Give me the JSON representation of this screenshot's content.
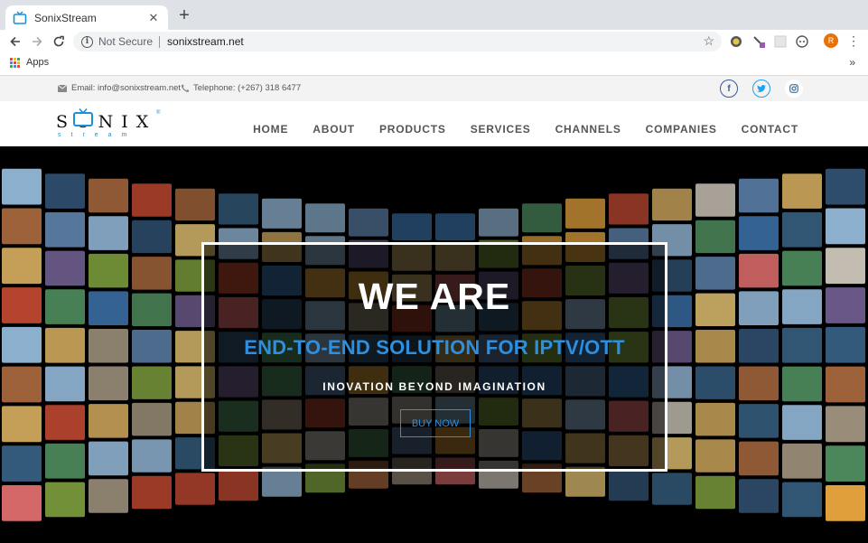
{
  "browser": {
    "tab_title": "SonixStream",
    "url_security": "Not Secure",
    "url": "sonixstream.net",
    "avatar_letter": "R",
    "bookmarks_apps": "Apps",
    "bookmarks_more": "»"
  },
  "topbar": {
    "email": "Email: info@sonixstream.net",
    "phone": "Telephone: (+267) 318 6477",
    "social": [
      "facebook-icon",
      "twitter-icon",
      "instagram-icon"
    ]
  },
  "logo": {
    "word": "SONIX",
    "sub": "stream",
    "reg": "®"
  },
  "nav": [
    "HOME",
    "ABOUT",
    "PRODUCTS",
    "SERVICES",
    "CHANNELS",
    "COMPANIES",
    "CONTACT"
  ],
  "hero": {
    "headline": "WE ARE",
    "subheadline": "END-TO-END SOLUTION FOR IPTV/OTT",
    "tagline": "INOVATION BEYOND IMAGINATION",
    "cta": "BUY NOW"
  },
  "colors": {
    "accent": "#2c8fe0",
    "nav_text": "#555555",
    "facebook": "#3b5998",
    "twitter": "#1da1f2",
    "instagram": "#3f729b"
  }
}
